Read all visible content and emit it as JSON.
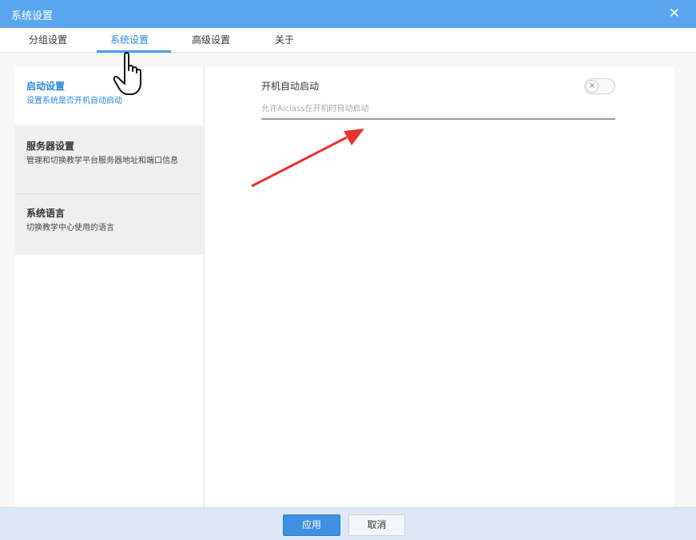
{
  "window": {
    "title": "系统设置",
    "close_icon": "close-icon",
    "close_glyph": "✕"
  },
  "tabs": [
    {
      "label": "分组设置",
      "active": false
    },
    {
      "label": "系统设置",
      "active": true
    },
    {
      "label": "高级设置",
      "active": false
    },
    {
      "label": "关于",
      "active": false
    }
  ],
  "sidebar": {
    "items": [
      {
        "title": "启动设置",
        "desc": "设置系统是否开机自动启动",
        "active": true
      },
      {
        "title": "服务器设置",
        "desc": "管理和切换教学平台服务器地址和端口信息",
        "active": false
      },
      {
        "title": "系统语言",
        "desc": "切换教学中心使用的语言",
        "active": false
      }
    ]
  },
  "setting": {
    "label": "开机自动启动",
    "description": "允许Aiclass在开机时自动启动",
    "toggle_on": false,
    "toggle_glyph": "×"
  },
  "footer": {
    "apply_label": "应用",
    "cancel_label": "取消"
  },
  "colors": {
    "accent": "#2b86da",
    "titlebar": "#5aa6ee",
    "arrow": "#e8322e"
  }
}
